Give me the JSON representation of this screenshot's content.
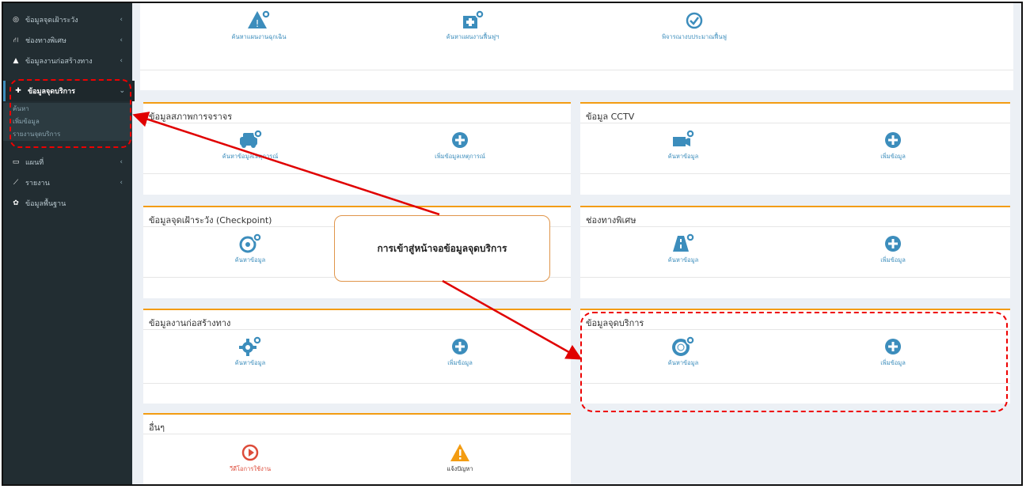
{
  "sidebar": {
    "items": [
      {
        "label": "ข้อมูลจุดเฝ้าระวัง",
        "icon": "crosshair-icon",
        "chevron": "‹"
      },
      {
        "label": "ช่องทางพิเศษ",
        "icon": "road-icon",
        "chevron": "‹"
      },
      {
        "label": "ข้อมูลงานก่อสร้างทาง",
        "icon": "warning-icon",
        "chevron": "‹"
      },
      {
        "label": "ข้อมูลจุดบริการ",
        "icon": "lifebuoy-icon",
        "chevron": "⌄"
      },
      {
        "label": "แผนที่",
        "icon": "map-icon",
        "chevron": "‹"
      },
      {
        "label": "รายงาน",
        "icon": "chart-icon",
        "chevron": "‹"
      },
      {
        "label": "ข้อมูลพื้นฐาน",
        "icon": "gear-icon",
        "chevron": ""
      }
    ],
    "submenu": [
      "ค้นหา",
      "เพิ่มข้อมูล",
      "รายงานจุดบริการ"
    ]
  },
  "top_panel": {
    "tiles": [
      "ค้นหาแผนงานฉุกเฉิน",
      "ค้นหาแผนงานฟื้นฟูฯ",
      "พิจารณางบประมาณฟื้นฟู"
    ]
  },
  "panels": {
    "traffic": {
      "title": "ข้อมูลสภาพการจราจร",
      "tiles": [
        "ค้นหาข้อมูลเหตุการณ์",
        "เพิ่มข้อมูลเหตุการณ์"
      ]
    },
    "cctv": {
      "title": "ข้อมูล CCTV",
      "tiles": [
        "ค้นหาข้อมูล",
        "เพิ่มข้อมูล"
      ]
    },
    "checkpoint": {
      "title": "ข้อมูลจุดเฝ้าระวัง (Checkpoint)",
      "tiles": [
        "ค้นหาข้อมูล"
      ]
    },
    "special_lane": {
      "title": "ช่องทางพิเศษ",
      "tiles": [
        "ค้นหาข้อมูล",
        "เพิ่มข้อมูล"
      ]
    },
    "construction": {
      "title": "ข้อมูลงานก่อสร้างทาง",
      "tiles": [
        "ค้นหาข้อมูล",
        "เพิ่มข้อมูล"
      ]
    },
    "service": {
      "title": "ข้อมูลจุดบริการ",
      "tiles": [
        "ค้นหาข้อมูล",
        "เพิ่มข้อมูล"
      ]
    },
    "other": {
      "title": "อื่นๆ",
      "tiles": [
        "วีดีโอการใช้งาน",
        "แจ้งปัญหา"
      ]
    }
  },
  "callout": {
    "text": "การเข้าสู่หน้าจอข้อมูลจุดบริการ"
  },
  "colors": {
    "accent": "#3c8dbc",
    "panel_border": "#f39c12",
    "annotation": "#e00000",
    "sidebar": "#222d32"
  }
}
